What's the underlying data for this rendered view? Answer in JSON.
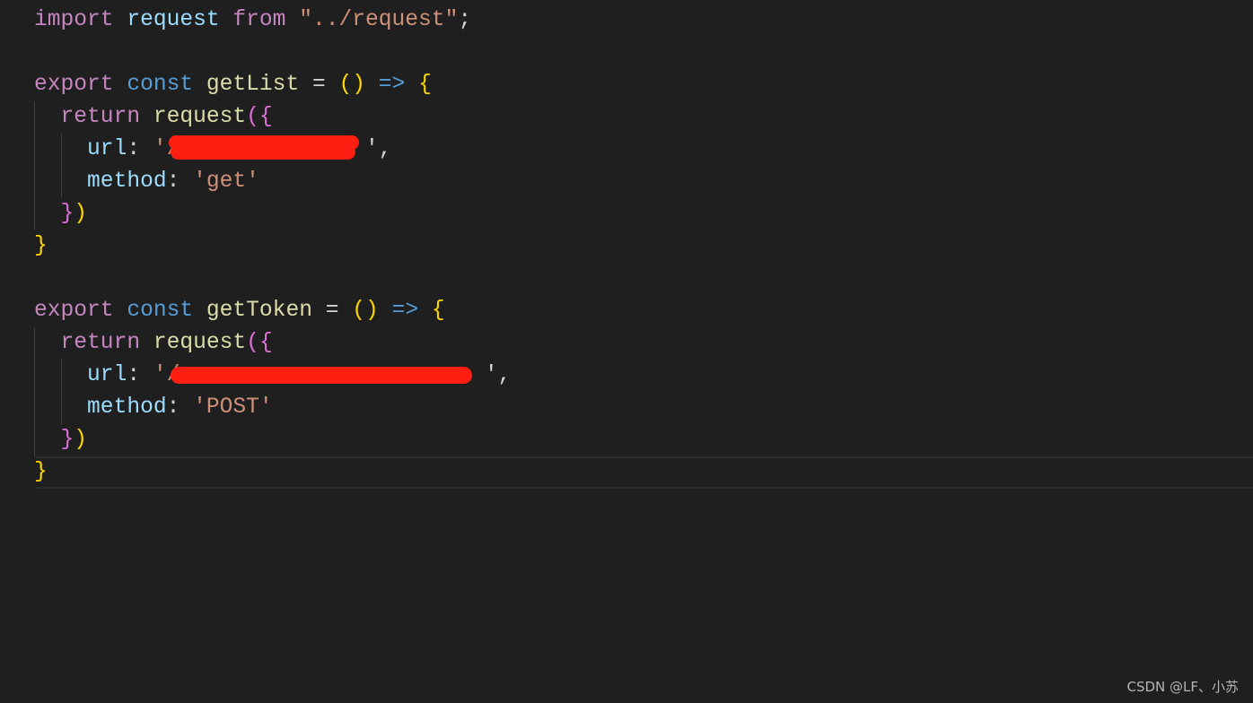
{
  "code": {
    "l0": {
      "kw1": "import",
      "id": "request",
      "kw2": "from",
      "path": "\"../request\"",
      "semi": ";"
    },
    "fn1": {
      "export": "export",
      "const": "const",
      "name": "getList",
      "eq": "=",
      "parens": "()",
      "arrow": "=>",
      "open": "{",
      "ret": "return",
      "call": "request",
      "p": "(",
      "b": "{",
      "url_key": "url",
      "colon": ":",
      "url_val": "'/",
      "url_end": "',",
      "method_key": "method",
      "method_val": "'get'",
      "close_b": "}",
      "close_p": ")",
      "close": "}"
    },
    "fn2": {
      "export": "export",
      "const": "const",
      "name": "getToken",
      "eq": "=",
      "parens": "()",
      "arrow": "=>",
      "open": "{",
      "ret": "return",
      "call": "request",
      "p": "(",
      "b": "{",
      "url_key": "url",
      "colon": ":",
      "url_val": "'/",
      "url_end": "',",
      "method_key": "method",
      "method_val": "'POST'",
      "close_b": "}",
      "close_p": ")",
      "close": "}"
    }
  },
  "colors": {
    "background": "#1f1f1f",
    "redaction": "#ff1e12",
    "keyword": "#c586c0",
    "storage": "#569cd6",
    "function": "#dcdcaa",
    "variable": "#9cdcfe",
    "string": "#ce9178"
  },
  "watermark": "CSDN @LF、小苏"
}
